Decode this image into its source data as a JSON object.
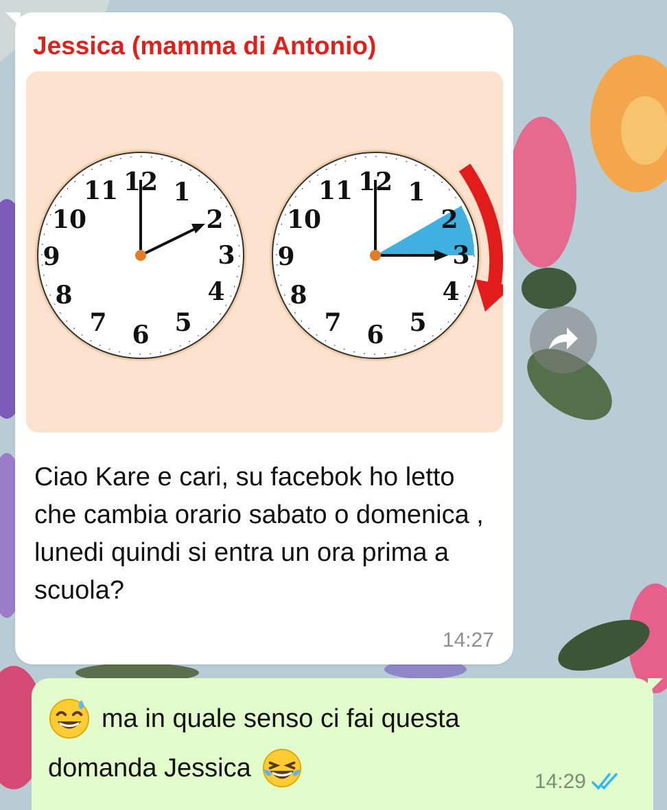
{
  "incoming": {
    "sender": "Jessica (mamma di Antonio)",
    "text": "Ciao Kare e cari, su facebok ho letto che cambia orario sabato o domenica , lunedi quindi si entra un ora prima a scuola?",
    "time": "14:27",
    "image": {
      "clock_numbers": [
        "12",
        "1",
        "2",
        "3",
        "4",
        "5",
        "6",
        "7",
        "8",
        "9",
        "10",
        "11"
      ]
    }
  },
  "outgoing": {
    "line1": "ma in quale senso ci fai questa",
    "line2": "domanda Jessica",
    "time": "14:29",
    "status_icon": "double-check-read-icon",
    "emojis": [
      "grinning-sweat-emoji",
      "tears-of-joy-emoji"
    ]
  },
  "colors": {
    "sender": "#e0201b",
    "outgoing_bubble": "#e2fccb",
    "read_check": "#34b7f1"
  }
}
